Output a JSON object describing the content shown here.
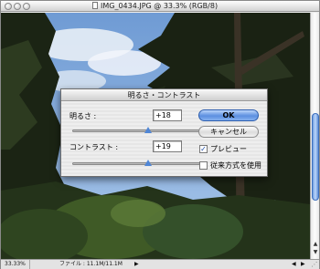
{
  "window": {
    "title": "IMG_0434.JPG @ 33.3% (RGB/8)"
  },
  "statusbar": {
    "zoom": "33.33%",
    "file_info": "ファイル : 11.1M/11.1M",
    "menu_arrow": "▶"
  },
  "dialog": {
    "title": "明るさ・コントラスト",
    "brightness": {
      "label": "明るさ :",
      "value": "+18",
      "level": 18,
      "range": [
        -100,
        100
      ]
    },
    "contrast": {
      "label": "コントラスト :",
      "value": "+19",
      "level": 19,
      "range": [
        -100,
        100
      ]
    },
    "ok_label": "OK",
    "cancel_label": "キャンセル",
    "preview": {
      "label": "プレビュー",
      "checked": true
    },
    "legacy": {
      "label": "従来方式を使用",
      "checked": false
    }
  },
  "colors": {
    "accent_blue": "#5b8fe0",
    "sky": "#8fb5e0",
    "foliage_dark": "#1d2616"
  },
  "icons": {
    "file": "file-icon",
    "slider_thumb": "triangle-up",
    "checkmark": "check-icon"
  }
}
